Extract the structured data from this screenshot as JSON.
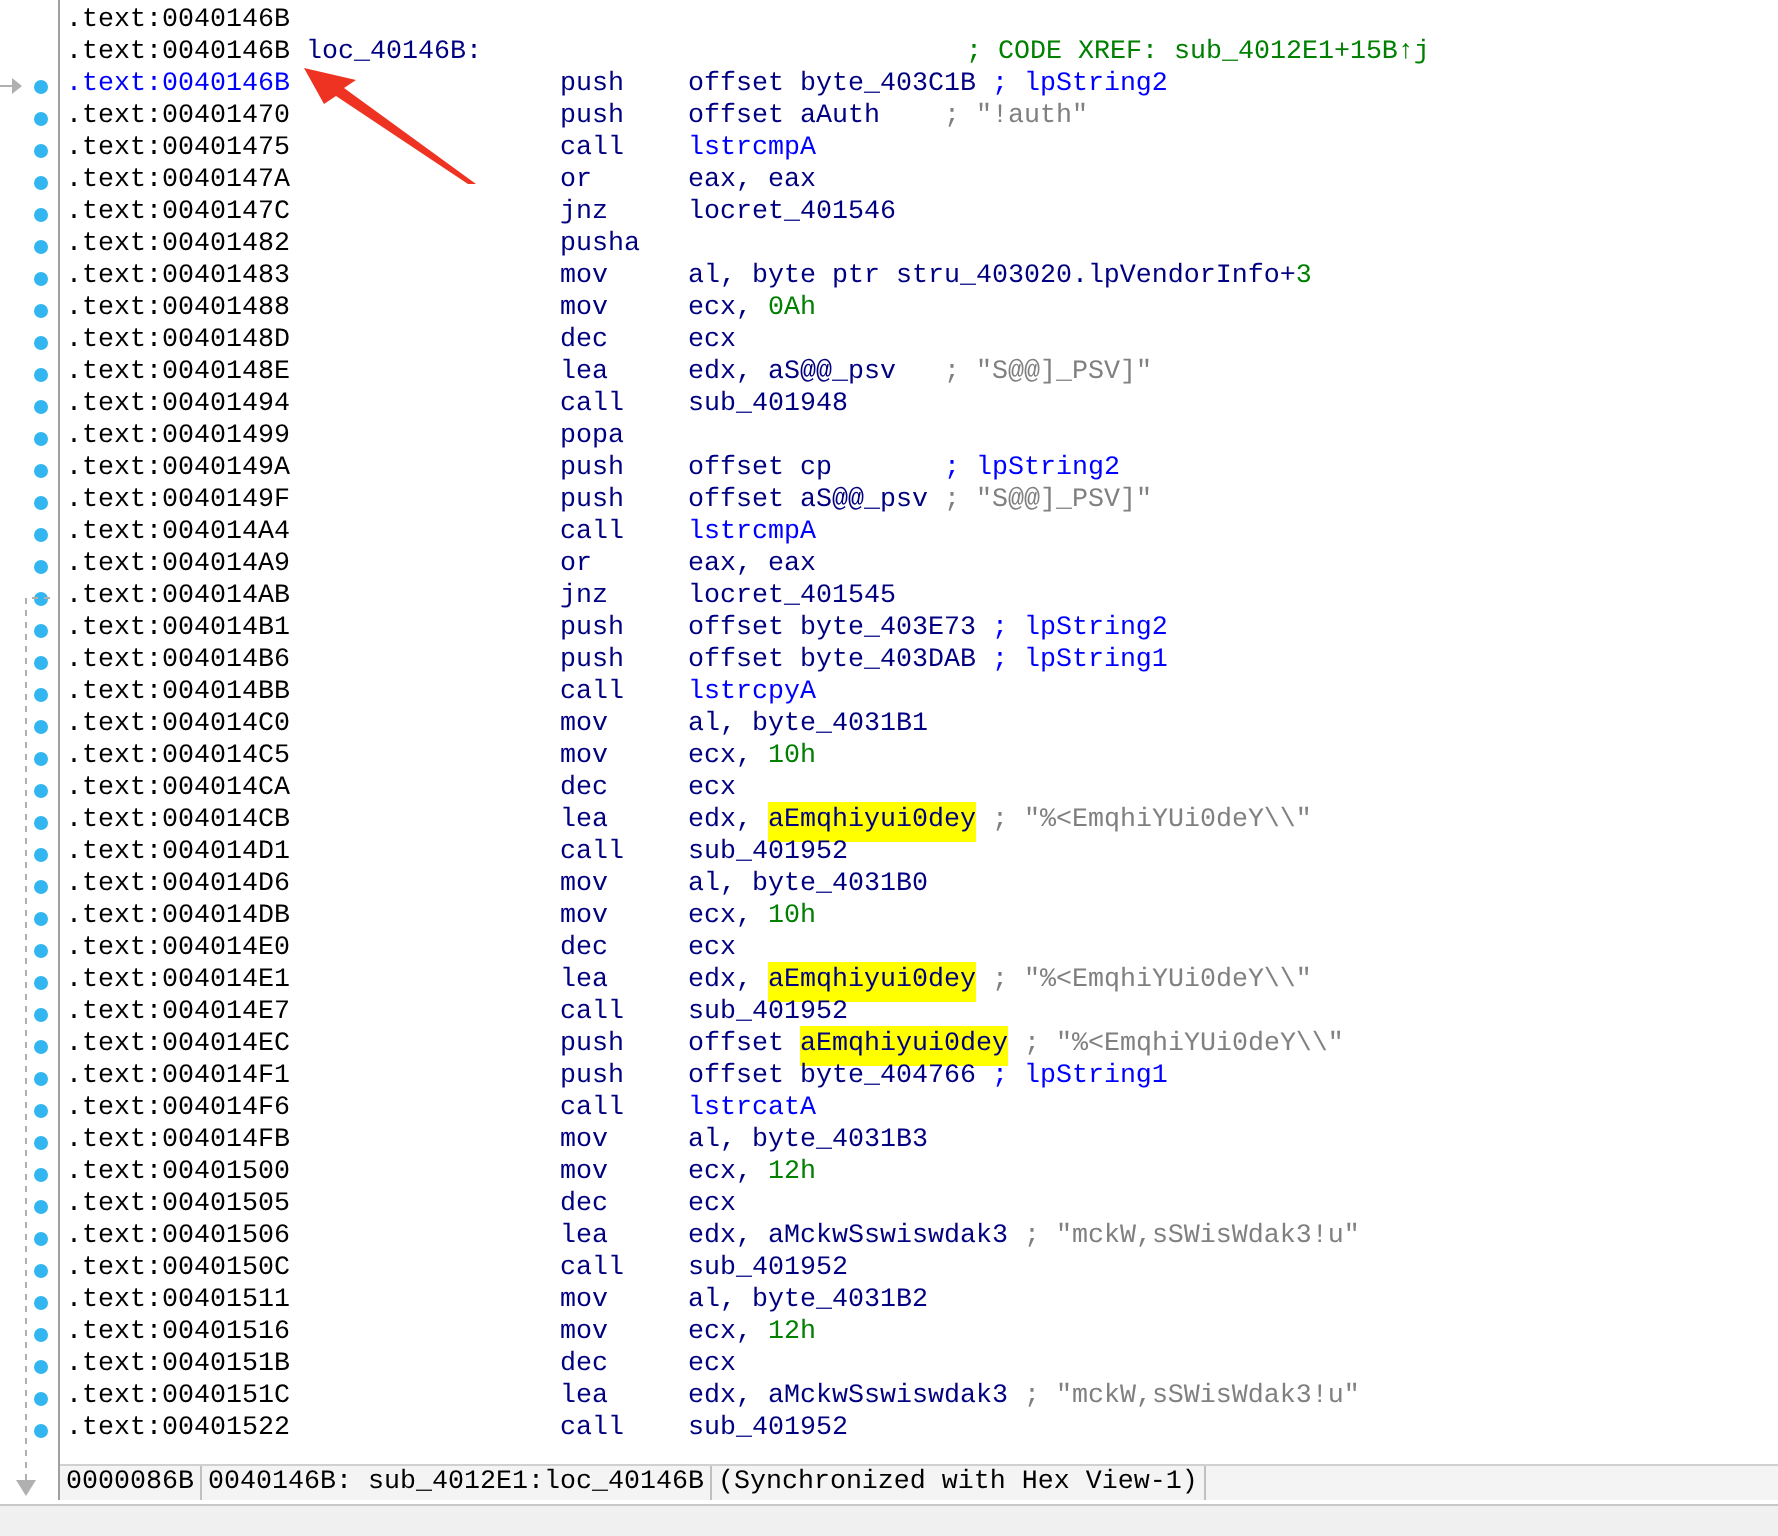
{
  "listing": [
    {
      "address": ".text:0040146B",
      "selected": false,
      "dot": false
    },
    {
      "address": ".text:0040146B",
      "label": "loc_40146B:",
      "selected": false,
      "dot": false,
      "parts": [
        {
          "t": "; CODE XREF: sub_4012E1+15B↑j",
          "kind": "xref"
        }
      ]
    },
    {
      "address": ".text:0040146B",
      "selected": true,
      "dot": true,
      "mnemonic": "push",
      "parts": [
        {
          "t": "offset byte_403C1B ",
          "kind": "text"
        },
        {
          "t": "; lpString2",
          "kind": "cmt"
        }
      ]
    },
    {
      "address": ".text:00401470",
      "selected": false,
      "dot": true,
      "mnemonic": "push",
      "parts": [
        {
          "t": "offset aAuth    ",
          "kind": "text"
        },
        {
          "t": "; \"!auth\"",
          "kind": "str"
        }
      ]
    },
    {
      "address": ".text:00401475",
      "selected": false,
      "dot": true,
      "mnemonic": "call",
      "parts": [
        {
          "t": "lstrcmpA",
          "kind": "import"
        }
      ]
    },
    {
      "address": ".text:0040147A",
      "selected": false,
      "dot": true,
      "mnemonic": "or",
      "parts": [
        {
          "t": "eax, eax",
          "kind": "text"
        }
      ]
    },
    {
      "address": ".text:0040147C",
      "selected": false,
      "dot": true,
      "mnemonic": "jnz",
      "parts": [
        {
          "t": "locret_401546",
          "kind": "text"
        }
      ]
    },
    {
      "address": ".text:00401482",
      "selected": false,
      "dot": true,
      "mnemonic": "pusha"
    },
    {
      "address": ".text:00401483",
      "selected": false,
      "dot": true,
      "mnemonic": "mov",
      "parts": [
        {
          "t": "al, byte ptr stru_403020.lpVendorInfo+",
          "kind": "text"
        },
        {
          "t": "3",
          "kind": "num"
        }
      ]
    },
    {
      "address": ".text:00401488",
      "selected": false,
      "dot": true,
      "mnemonic": "mov",
      "parts": [
        {
          "t": "ecx, ",
          "kind": "text"
        },
        {
          "t": "0Ah",
          "kind": "num"
        }
      ]
    },
    {
      "address": ".text:0040148D",
      "selected": false,
      "dot": true,
      "mnemonic": "dec",
      "parts": [
        {
          "t": "ecx",
          "kind": "text"
        }
      ]
    },
    {
      "address": ".text:0040148E",
      "selected": false,
      "dot": true,
      "mnemonic": "lea",
      "parts": [
        {
          "t": "edx, aS@@_psv   ",
          "kind": "text"
        },
        {
          "t": "; \"S@@]_PSV]\"",
          "kind": "str"
        }
      ]
    },
    {
      "address": ".text:00401494",
      "selected": false,
      "dot": true,
      "mnemonic": "call",
      "parts": [
        {
          "t": "sub_401948",
          "kind": "text"
        }
      ]
    },
    {
      "address": ".text:00401499",
      "selected": false,
      "dot": true,
      "mnemonic": "popa"
    },
    {
      "address": ".text:0040149A",
      "selected": false,
      "dot": true,
      "mnemonic": "push",
      "parts": [
        {
          "t": "offset cp       ",
          "kind": "text"
        },
        {
          "t": "; lpString2",
          "kind": "cmt"
        }
      ]
    },
    {
      "address": ".text:0040149F",
      "selected": false,
      "dot": true,
      "mnemonic": "push",
      "parts": [
        {
          "t": "offset aS@@_psv ",
          "kind": "text"
        },
        {
          "t": "; \"S@@]_PSV]\"",
          "kind": "str"
        }
      ]
    },
    {
      "address": ".text:004014A4",
      "selected": false,
      "dot": true,
      "mnemonic": "call",
      "parts": [
        {
          "t": "lstrcmpA",
          "kind": "import"
        }
      ]
    },
    {
      "address": ".text:004014A9",
      "selected": false,
      "dot": true,
      "mnemonic": "or",
      "parts": [
        {
          "t": "eax, eax",
          "kind": "text"
        }
      ]
    },
    {
      "address": ".text:004014AB",
      "selected": false,
      "dot": true,
      "mnemonic": "jnz",
      "parts": [
        {
          "t": "locret_401545",
          "kind": "text"
        }
      ]
    },
    {
      "address": ".text:004014B1",
      "selected": false,
      "dot": true,
      "mnemonic": "push",
      "parts": [
        {
          "t": "offset byte_403E73 ",
          "kind": "text"
        },
        {
          "t": "; lpString2",
          "kind": "cmt"
        }
      ]
    },
    {
      "address": ".text:004014B6",
      "selected": false,
      "dot": true,
      "mnemonic": "push",
      "parts": [
        {
          "t": "offset byte_403DAB ",
          "kind": "text"
        },
        {
          "t": "; lpString1",
          "kind": "cmt"
        }
      ]
    },
    {
      "address": ".text:004014BB",
      "selected": false,
      "dot": true,
      "mnemonic": "call",
      "parts": [
        {
          "t": "lstrcpyA",
          "kind": "import"
        }
      ]
    },
    {
      "address": ".text:004014C0",
      "selected": false,
      "dot": true,
      "mnemonic": "mov",
      "parts": [
        {
          "t": "al, byte_4031B1",
          "kind": "text"
        }
      ]
    },
    {
      "address": ".text:004014C5",
      "selected": false,
      "dot": true,
      "mnemonic": "mov",
      "parts": [
        {
          "t": "ecx, ",
          "kind": "text"
        },
        {
          "t": "10h",
          "kind": "num"
        }
      ]
    },
    {
      "address": ".text:004014CA",
      "selected": false,
      "dot": true,
      "mnemonic": "dec",
      "parts": [
        {
          "t": "ecx",
          "kind": "text"
        }
      ]
    },
    {
      "address": ".text:004014CB",
      "selected": false,
      "dot": true,
      "mnemonic": "lea",
      "parts": [
        {
          "t": "edx, ",
          "kind": "text"
        },
        {
          "t": "aEmqhiyui0dey",
          "kind": "hl"
        },
        {
          "t": " ; \"%<EmqhiYUi0deY\\\\\"",
          "kind": "str"
        }
      ]
    },
    {
      "address": ".text:004014D1",
      "selected": false,
      "dot": true,
      "mnemonic": "call",
      "parts": [
        {
          "t": "sub_401952",
          "kind": "text"
        }
      ]
    },
    {
      "address": ".text:004014D6",
      "selected": false,
      "dot": true,
      "mnemonic": "mov",
      "parts": [
        {
          "t": "al, byte_4031B0",
          "kind": "text"
        }
      ]
    },
    {
      "address": ".text:004014DB",
      "selected": false,
      "dot": true,
      "mnemonic": "mov",
      "parts": [
        {
          "t": "ecx, ",
          "kind": "text"
        },
        {
          "t": "10h",
          "kind": "num"
        }
      ]
    },
    {
      "address": ".text:004014E0",
      "selected": false,
      "dot": true,
      "mnemonic": "dec",
      "parts": [
        {
          "t": "ecx",
          "kind": "text"
        }
      ]
    },
    {
      "address": ".text:004014E1",
      "selected": false,
      "dot": true,
      "mnemonic": "lea",
      "parts": [
        {
          "t": "edx, ",
          "kind": "text"
        },
        {
          "t": "aEmqhiyui0dey",
          "kind": "hl"
        },
        {
          "t": " ; \"%<EmqhiYUi0deY\\\\\"",
          "kind": "str"
        }
      ]
    },
    {
      "address": ".text:004014E7",
      "selected": false,
      "dot": true,
      "mnemonic": "call",
      "parts": [
        {
          "t": "sub_401952",
          "kind": "text"
        }
      ]
    },
    {
      "address": ".text:004014EC",
      "selected": false,
      "dot": true,
      "mnemonic": "push",
      "parts": [
        {
          "t": "offset ",
          "kind": "text"
        },
        {
          "t": "aEmqhiyui0dey",
          "kind": "hl"
        },
        {
          "t": " ; \"%<EmqhiYUi0deY\\\\\"",
          "kind": "str"
        }
      ]
    },
    {
      "address": ".text:004014F1",
      "selected": false,
      "dot": true,
      "mnemonic": "push",
      "parts": [
        {
          "t": "offset byte_404766 ",
          "kind": "text"
        },
        {
          "t": "; lpString1",
          "kind": "cmt"
        }
      ]
    },
    {
      "address": ".text:004014F6",
      "selected": false,
      "dot": true,
      "mnemonic": "call",
      "parts": [
        {
          "t": "lstrcatA",
          "kind": "import"
        }
      ]
    },
    {
      "address": ".text:004014FB",
      "selected": false,
      "dot": true,
      "mnemonic": "mov",
      "parts": [
        {
          "t": "al, byte_4031B3",
          "kind": "text"
        }
      ]
    },
    {
      "address": ".text:00401500",
      "selected": false,
      "dot": true,
      "mnemonic": "mov",
      "parts": [
        {
          "t": "ecx, ",
          "kind": "text"
        },
        {
          "t": "12h",
          "kind": "num"
        }
      ]
    },
    {
      "address": ".text:00401505",
      "selected": false,
      "dot": true,
      "mnemonic": "dec",
      "parts": [
        {
          "t": "ecx",
          "kind": "text"
        }
      ]
    },
    {
      "address": ".text:00401506",
      "selected": false,
      "dot": true,
      "mnemonic": "lea",
      "parts": [
        {
          "t": "edx, aMckwSswiswdak3 ",
          "kind": "text"
        },
        {
          "t": "; \"mckW,sSWisWdak3!u\"",
          "kind": "str"
        }
      ]
    },
    {
      "address": ".text:0040150C",
      "selected": false,
      "dot": true,
      "mnemonic": "call",
      "parts": [
        {
          "t": "sub_401952",
          "kind": "text"
        }
      ]
    },
    {
      "address": ".text:00401511",
      "selected": false,
      "dot": true,
      "mnemonic": "mov",
      "parts": [
        {
          "t": "al, byte_4031B2",
          "kind": "text"
        }
      ]
    },
    {
      "address": ".text:00401516",
      "selected": false,
      "dot": true,
      "mnemonic": "mov",
      "parts": [
        {
          "t": "ecx, ",
          "kind": "text"
        },
        {
          "t": "12h",
          "kind": "num"
        }
      ]
    },
    {
      "address": ".text:0040151B",
      "selected": false,
      "dot": true,
      "mnemonic": "dec",
      "parts": [
        {
          "t": "ecx",
          "kind": "text"
        }
      ]
    },
    {
      "address": ".text:0040151C",
      "selected": false,
      "dot": true,
      "mnemonic": "lea",
      "parts": [
        {
          "t": "edx, aMckwSswiswdak3 ",
          "kind": "text"
        },
        {
          "t": "; \"mckW,sSWisWdak3!u\"",
          "kind": "str"
        }
      ]
    },
    {
      "address": ".text:00401522",
      "selected": false,
      "dot": true,
      "mnemonic": "call",
      "parts": [
        {
          "t": "sub_401952",
          "kind": "text"
        }
      ]
    }
  ],
  "status_bar": [
    "0000086B",
    "0040146B: sub_4012E1:loc_40146B",
    "(Synchronized with Hex View-1)"
  ]
}
